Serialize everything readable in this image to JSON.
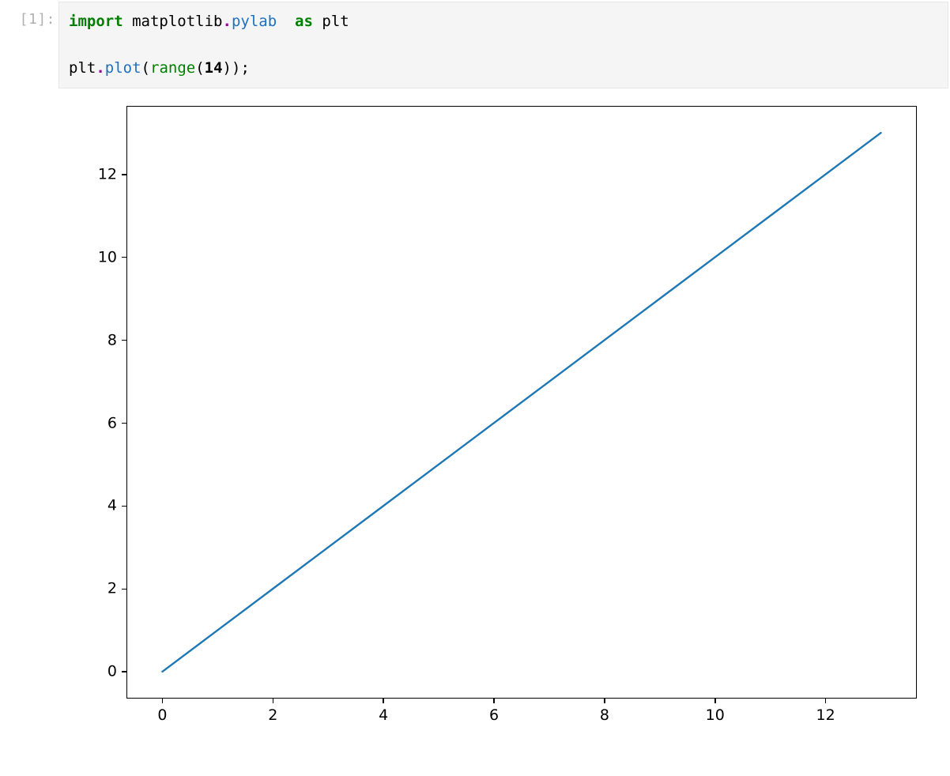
{
  "cell": {
    "prompt_number": "1",
    "prompt_open": "[",
    "prompt_close": "]",
    "prompt_colon": ":",
    "code_tokens": [
      {
        "t": "import",
        "c": "tok-kw"
      },
      {
        "t": " ",
        "c": ""
      },
      {
        "t": "matplotlib",
        "c": "tok-name"
      },
      {
        "t": ".",
        "c": "tok-op"
      },
      {
        "t": "pylab",
        "c": "tok-attr"
      },
      {
        "t": "  ",
        "c": ""
      },
      {
        "t": "as",
        "c": "tok-kw"
      },
      {
        "t": " ",
        "c": ""
      },
      {
        "t": "plt",
        "c": "tok-name"
      },
      {
        "t": "\n\n",
        "c": ""
      },
      {
        "t": "plt",
        "c": "tok-name"
      },
      {
        "t": ".",
        "c": "tok-op"
      },
      {
        "t": "plot",
        "c": "tok-attr"
      },
      {
        "t": "(",
        "c": "tok-punct"
      },
      {
        "t": "range",
        "c": "tok-builtin"
      },
      {
        "t": "(",
        "c": "tok-punct"
      },
      {
        "t": "14",
        "c": "tok-num"
      },
      {
        "t": ")",
        "c": "tok-punct"
      },
      {
        "t": ")",
        "c": "tok-punct"
      },
      {
        "t": ";",
        "c": "tok-punct"
      }
    ]
  },
  "chart_data": {
    "type": "line",
    "x": [
      0,
      1,
      2,
      3,
      4,
      5,
      6,
      7,
      8,
      9,
      10,
      11,
      12,
      13
    ],
    "y": [
      0,
      1,
      2,
      3,
      4,
      5,
      6,
      7,
      8,
      9,
      10,
      11,
      12,
      13
    ],
    "x_ticks": [
      0,
      2,
      4,
      6,
      8,
      10,
      12
    ],
    "y_ticks": [
      0,
      2,
      4,
      6,
      8,
      10,
      12
    ],
    "xlim": [
      -0.65,
      13.65
    ],
    "ylim": [
      -0.65,
      13.65
    ],
    "line_color": "#1f77b4",
    "line_width": 2.4,
    "title": "",
    "xlabel": "",
    "ylabel": "",
    "layout": {
      "fig_w": 1090,
      "fig_h": 830,
      "axes_left": 90,
      "axes_top": 12,
      "axes_w": 1000,
      "axes_h": 750,
      "tick_mark_len": 6
    }
  }
}
